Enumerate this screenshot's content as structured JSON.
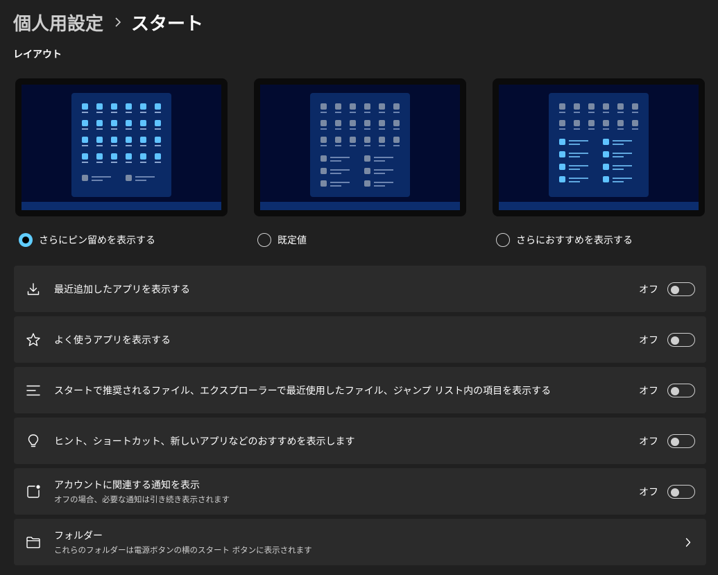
{
  "breadcrumb": {
    "parent": "個人用設定",
    "current": "スタート"
  },
  "layout_section": {
    "title": "レイアウト",
    "options": [
      {
        "label": "さらにピン留めを表示する",
        "selected": true
      },
      {
        "label": "既定値",
        "selected": false
      },
      {
        "label": "さらにおすすめを表示する",
        "selected": false
      }
    ]
  },
  "settings": [
    {
      "icon": "download-icon",
      "title": "最近追加したアプリを表示する",
      "state": "オフ"
    },
    {
      "icon": "star-icon",
      "title": "よく使うアプリを表示する",
      "state": "オフ"
    },
    {
      "icon": "list-icon",
      "title": "スタートで推奨されるファイル、エクスプローラーで最近使用したファイル、ジャンプ リスト内の項目を表示する",
      "state": "オフ"
    },
    {
      "icon": "lightbulb-icon",
      "title": "ヒント、ショートカット、新しいアプリなどのおすすめを表示します",
      "state": "オフ"
    },
    {
      "icon": "account-notification-icon",
      "title": "アカウントに関連する通知を表示",
      "subtitle": "オフの場合、必要な通知は引き続き表示されます",
      "state": "オフ"
    },
    {
      "icon": "folder-icon",
      "title": "フォルダー",
      "subtitle": "これらのフォルダーは電源ボタンの横のスタート ボタンに表示されます"
    }
  ],
  "colors": {
    "background": "#202020",
    "card": "#2b2b2b",
    "accent": "#60cdff",
    "preview_screen": "#020b30",
    "preview_startmenu": "#0b2a66"
  }
}
